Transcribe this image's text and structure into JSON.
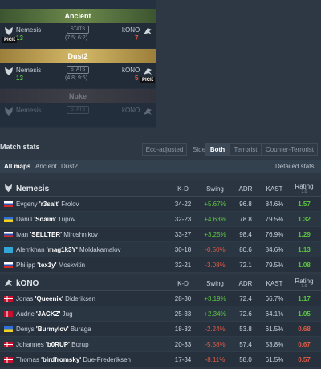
{
  "maps": [
    {
      "name": "Ancient",
      "banner_color": "#4f6b3a",
      "team1": "Nemesis",
      "team2": "kONO",
      "score1": "13",
      "score2": "7",
      "stats_label": "STATS",
      "half_line": "(7:5; 6:2)",
      "half_a": "(7:5;",
      "half_b": "6:2)",
      "pick": "left",
      "pick_label": "PICK",
      "faded": false
    },
    {
      "name": "Dust2",
      "banner_color": "#b99a4e",
      "team1": "Nemesis",
      "team2": "kONO",
      "score1": "13",
      "score2": "5",
      "stats_label": "STATS",
      "half_line": "(4:8; 9:5)",
      "half_a": "(4:8;",
      "half_b": "9:5)",
      "pick": "right",
      "pick_label": "PICK",
      "faded": false
    },
    {
      "name": "Nuke",
      "banner_color": "#5a4642",
      "team1": "Nemesis",
      "team2": "kONO",
      "score1": "",
      "score2": "",
      "stats_label": "STATS",
      "half_line": "",
      "pick": "",
      "faded": true
    }
  ],
  "match_stats": {
    "title": "Match stats",
    "eco_label": "Eco-adjusted",
    "side_label": "Side",
    "side_options": [
      "Both",
      "Terrorist",
      "Counter-Terrorist"
    ],
    "side_selected": "Both",
    "filters": [
      "All maps",
      "Ancient",
      "Dust2"
    ],
    "filter_selected": "All maps",
    "detailed_label": "Detailed stats"
  },
  "columns": {
    "kd": "K-D",
    "swing": "Swing",
    "adr": "ADR",
    "kast": "KAST",
    "rating": "Rating",
    "rating_sub": "3.0"
  },
  "teams": [
    {
      "name": "Nemesis",
      "players": [
        {
          "flag": "ru",
          "first": "Evgeny ",
          "nick": "'r3salt'",
          "last": " Frolov",
          "kd": "34-22",
          "swing": "+5.67%",
          "adr": "96.8",
          "kast": "84.6%",
          "rating": "1.57"
        },
        {
          "flag": "ua",
          "first": "Daniil ",
          "nick": "'Sdaim'",
          "last": " Tupov",
          "kd": "32-23",
          "swing": "+4.63%",
          "adr": "78.8",
          "kast": "79.5%",
          "rating": "1.32"
        },
        {
          "flag": "ru",
          "first": "Ivan ",
          "nick": "'SELLTER'",
          "last": " Miroshnikov",
          "kd": "33-27",
          "swing": "+3.25%",
          "adr": "98.4",
          "kast": "76.9%",
          "rating": "1.29"
        },
        {
          "flag": "kz",
          "first": "Alemkhan ",
          "nick": "'mag1k3Y'",
          "last": " Moldakamalov",
          "kd": "30-18",
          "swing": "-0.50%",
          "adr": "80.6",
          "kast": "84.6%",
          "rating": "1.13"
        },
        {
          "flag": "ru",
          "first": "Philipp ",
          "nick": "'tex1y'",
          "last": " Moskvitin",
          "kd": "32-21",
          "swing": "-3.08%",
          "adr": "72.1",
          "kast": "79.5%",
          "rating": "1.08"
        }
      ]
    },
    {
      "name": "kONO",
      "players": [
        {
          "flag": "dk",
          "first": "Jonas ",
          "nick": "'Queenix'",
          "last": " Dideriksen",
          "kd": "28-30",
          "swing": "+3.19%",
          "adr": "72.4",
          "kast": "66.7%",
          "rating": "1.17"
        },
        {
          "flag": "dk",
          "first": "Audric ",
          "nick": "'JACKZ'",
          "last": " Jug",
          "kd": "25-33",
          "swing": "+2.34%",
          "adr": "72.6",
          "kast": "64.1%",
          "rating": "1.05"
        },
        {
          "flag": "ua",
          "first": "Denys ",
          "nick": "'Burmylov'",
          "last": " Buraga",
          "kd": "18-32",
          "swing": "-2.24%",
          "adr": "53.8",
          "kast": "61.5%",
          "rating": "0.68"
        },
        {
          "flag": "dk",
          "first": "Johannes ",
          "nick": "'b0RUP'",
          "last": " Borup",
          "kd": "20-33",
          "swing": "-5.58%",
          "adr": "57.4",
          "kast": "53.8%",
          "rating": "0.67"
        },
        {
          "flag": "dk",
          "first": "Thomas ",
          "nick": "'birdfromsky'",
          "last": " Due-Frederiksen",
          "kd": "17-34",
          "swing": "-8.11%",
          "adr": "58.0",
          "kast": "61.5%",
          "rating": "0.57"
        }
      ]
    }
  ],
  "colors": {
    "positive": "#5cc542",
    "negative": "#e05a45",
    "background": "#2d3844"
  }
}
